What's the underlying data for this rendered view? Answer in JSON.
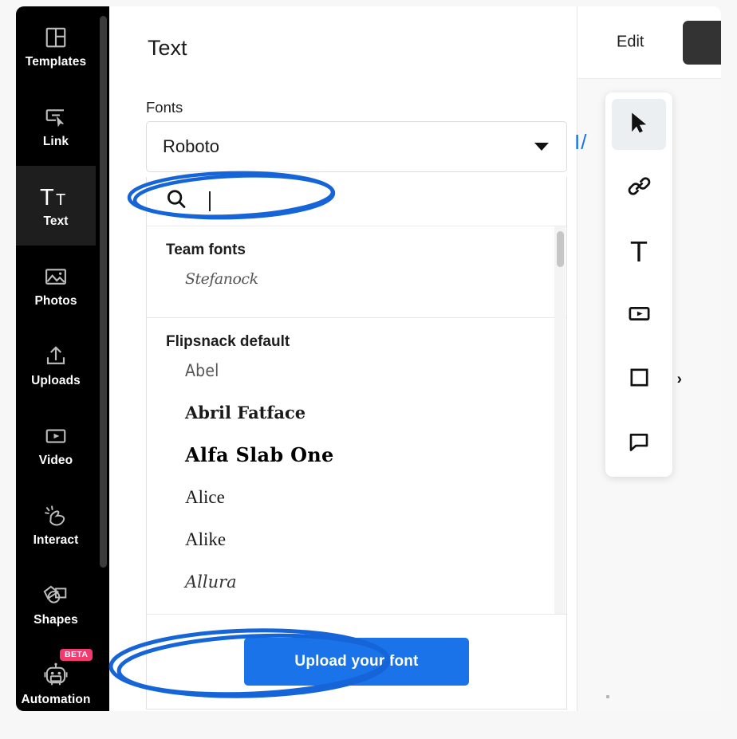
{
  "app": {
    "accent_blue": "#1a73e8",
    "annotation_color": "#1565d8",
    "sidebar_bg": "#000000",
    "selected_item_bg": "#1e1e1e",
    "badge_color": "#f13a6e"
  },
  "sidebar": {
    "items": [
      {
        "label": "Templates",
        "icon": "templates-icon",
        "selected": false
      },
      {
        "label": "Link",
        "icon": "link-cursor-icon",
        "selected": false
      },
      {
        "label": "Text",
        "icon": "text-tt-icon",
        "selected": true
      },
      {
        "label": "Photos",
        "icon": "photo-icon",
        "selected": false
      },
      {
        "label": "Uploads",
        "icon": "upload-arrow-icon",
        "selected": false
      },
      {
        "label": "Video",
        "icon": "video-play-icon",
        "selected": false
      },
      {
        "label": "Interact",
        "icon": "hand-tap-icon",
        "selected": false
      },
      {
        "label": "Shapes",
        "icon": "shapes-icon",
        "selected": false
      },
      {
        "label": "Automation",
        "icon": "robot-icon",
        "selected": false,
        "badge": "BETA"
      }
    ]
  },
  "panel": {
    "title": "Text",
    "fonts_label": "Fonts",
    "font_select": {
      "value": "Roboto",
      "caret_icon": "chevron-down-icon"
    },
    "dropdown": {
      "search": {
        "icon": "search-icon",
        "value": "",
        "placeholder": ""
      },
      "groups": [
        {
          "title": "Team fonts",
          "options": [
            {
              "label": "Stefanock",
              "style": "f-stefanock"
            }
          ]
        },
        {
          "title": "Flipsnack default",
          "options": [
            {
              "label": "Abel",
              "style": "f-abel"
            },
            {
              "label": "Abril Fatface",
              "style": "f-abril"
            },
            {
              "label": "Alfa Slab One",
              "style": "f-alfa"
            },
            {
              "label": "Alice",
              "style": "f-alice"
            },
            {
              "label": "Alike",
              "style": "f-alike"
            },
            {
              "label": "Allura",
              "style": "f-allura"
            }
          ]
        }
      ],
      "upload_button": "Upload your font"
    }
  },
  "right": {
    "edit_label": "Edit",
    "color_swatch": "#333333",
    "canvas_text_fragment": "I/",
    "toolbar": [
      {
        "icon": "cursor-arrow-icon",
        "active": true
      },
      {
        "icon": "link-chain-icon",
        "active": false
      },
      {
        "icon": "text-t-icon",
        "active": false,
        "glyph": "T"
      },
      {
        "icon": "video-play-icon",
        "active": false
      },
      {
        "icon": "shape-square-icon",
        "active": false,
        "chevron": "›"
      },
      {
        "icon": "comment-bubble-icon",
        "active": false
      }
    ]
  },
  "annotations": [
    {
      "name": "search-field-highlight",
      "shape": "ellipse"
    },
    {
      "name": "upload-font-button-highlight",
      "shape": "ellipse"
    }
  ]
}
